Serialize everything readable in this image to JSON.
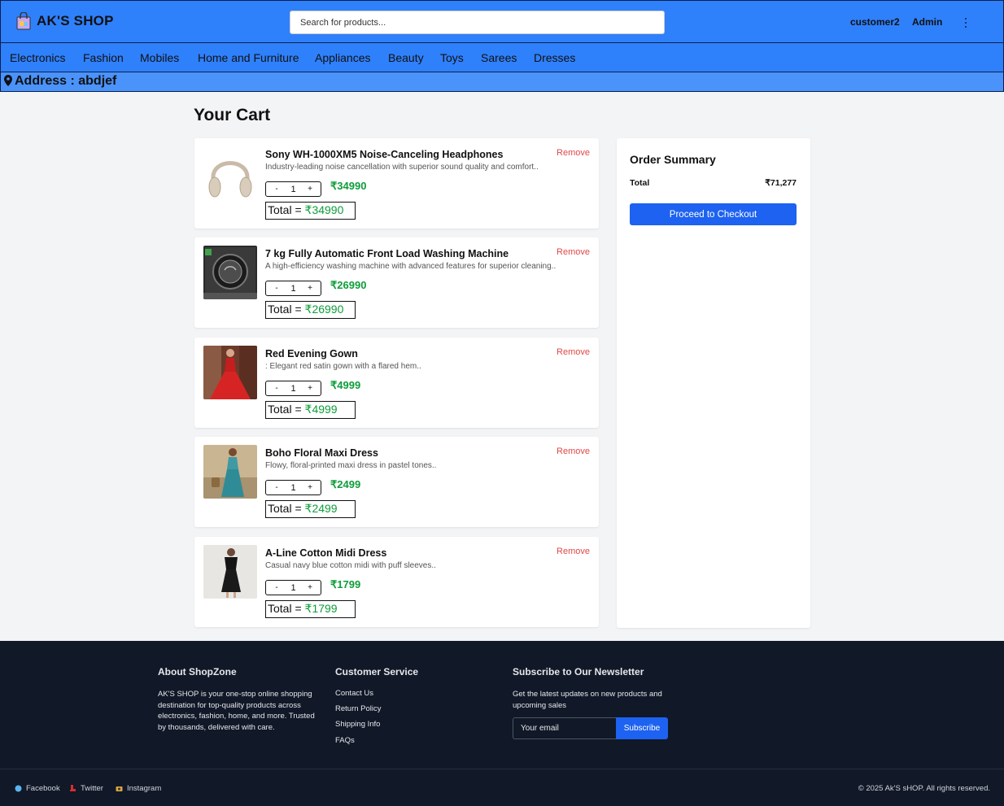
{
  "header": {
    "brand": "AK'S SHOP",
    "search_placeholder": "Search for products...",
    "user": "customer2",
    "admin": "Admin"
  },
  "categories": [
    "Electronics",
    "Fashion",
    "Mobiles",
    "Home and Furniture",
    "Appliances",
    "Beauty",
    "Toys",
    "Sarees",
    "Dresses"
  ],
  "address": "Address : abdjef",
  "cart": {
    "title": "Your Cart",
    "remove_label": "Remove",
    "total_label": "Total = ",
    "items": [
      {
        "name": "Sony WH-1000XM5 Noise-Canceling Headphones",
        "description": "Industry-leading noise cancellation with superior sound quality and comfort..",
        "qty": "1",
        "price": "₹34990",
        "total": "₹34990",
        "image": "headphones-image"
      },
      {
        "name": "7 kg Fully Automatic Front Load Washing Machine",
        "description": "A high-efficiency washing machine with advanced features for superior cleaning..",
        "qty": "1",
        "price": "₹26990",
        "total": "₹26990",
        "image": "washing-machine-image"
      },
      {
        "name": "Red Evening Gown",
        "description": ": Elegant red satin gown with a flared hem..",
        "qty": "1",
        "price": "₹4999",
        "total": "₹4999",
        "image": "red-gown-image"
      },
      {
        "name": "Boho Floral Maxi Dress",
        "description": "Flowy, floral-printed maxi dress in pastel tones..",
        "qty": "1",
        "price": "₹2499",
        "total": "₹2499",
        "image": "boho-dress-image"
      },
      {
        "name": "A-Line Cotton Midi Dress",
        "description": "Casual navy blue cotton midi with puff sleeves..",
        "qty": "1",
        "price": "₹1799",
        "total": "₹1799",
        "image": "midi-dress-image"
      }
    ]
  },
  "summary": {
    "title": "Order Summary",
    "total_label": "Total",
    "total_value": "₹71,277",
    "checkout_label": "Proceed to Checkout"
  },
  "footer": {
    "about_title": "About ShopZone",
    "about_text": "AK'S SHOP is your one-stop online shopping destination for top-quality products across electronics, fashion, home, and more. Trusted by thousands, delivered with care.",
    "service_title": "Customer Service",
    "service_links": [
      "Contact Us",
      "Return Policy",
      "Shipping Info",
      "FAQs"
    ],
    "newsletter_title": "Subscribe to Our Newsletter",
    "newsletter_text": "Get the latest updates on new products and upcoming sales",
    "email_placeholder": "Your email",
    "subscribe_label": "Subscribe",
    "social": [
      "Facebook",
      "Twitter",
      "Instagram"
    ],
    "copyright": "© 2025 Ak'S sHOP. All rights reserved."
  },
  "colors": {
    "header_blue": "#2f80fb",
    "price_green": "#0d9d3a",
    "remove_red": "#e04848",
    "button_blue": "#1d62f0",
    "footer_bg": "#111827"
  }
}
